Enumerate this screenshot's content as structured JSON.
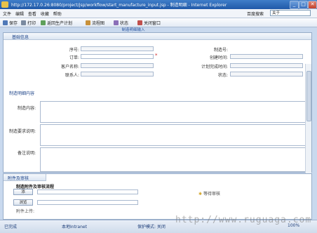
{
  "window": {
    "title": "http://172.17.0.26:8080/project/jsp/workflow/start_manufacture_input.jsp - 制造明细 - Internet Explorer",
    "minimize": "_",
    "maximize": "□",
    "close": "✕"
  },
  "menu": {
    "items": [
      "文件",
      "编辑",
      "查看",
      "收藏",
      "帮助"
    ],
    "search_label": "百度搜索",
    "search_value": "关于"
  },
  "toolbar": {
    "items": [
      "保存",
      "打印",
      "返回生产计划",
      "流程图",
      "状态",
      "关闭窗口"
    ]
  },
  "page_tab": "制造明细输入",
  "basic": {
    "header": "基础信息",
    "left_fields": [
      {
        "label": "序号:",
        "required": false
      },
      {
        "label": "订单:",
        "required": true
      },
      {
        "label": "客户名称:",
        "required": false
      },
      {
        "label": "联系人:",
        "required": false
      }
    ],
    "right_fields": [
      {
        "label": "制造号:",
        "required": false
      },
      {
        "label": "创建时间:",
        "required": false
      },
      {
        "label": "计划完成时间:",
        "required": false
      },
      {
        "label": "状态:",
        "required": false
      }
    ]
  },
  "detail": {
    "header": "制造明细内容",
    "areas": [
      {
        "label": "制造内容:"
      },
      {
        "label": "制造要求说明:"
      },
      {
        "label": "备注说明:"
      }
    ]
  },
  "attachment": {
    "header": "附件及审核",
    "subheader": "制造附件及审核流程",
    "add_button": "添",
    "browse_button": "浏览",
    "file_hint": "附件上传:",
    "status_note": "等待审核"
  },
  "statusbar": {
    "items": [
      "已完成",
      "本地Intranet",
      "保护模式: 关闭",
      "100%"
    ]
  },
  "watermark": "http://www.ruguaga.com"
}
